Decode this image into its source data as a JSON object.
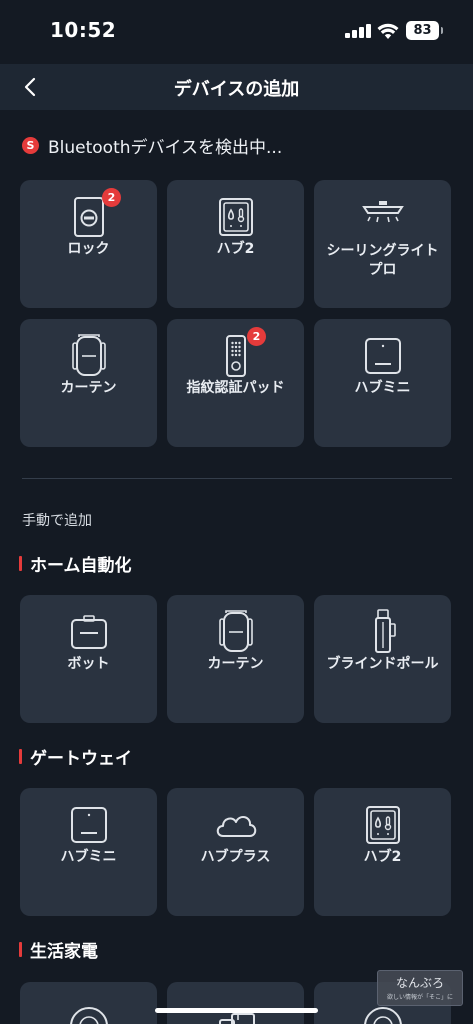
{
  "status": {
    "time": "10:52",
    "battery": "83"
  },
  "nav": {
    "title": "デバイスの追加"
  },
  "scan": {
    "icon_letter": "S",
    "text": "Bluetoothデバイスを検出中..."
  },
  "bluetooth_devices": [
    {
      "label": "ロック",
      "icon": "lock-icon",
      "badge": "2"
    },
    {
      "label": "ハブ2",
      "icon": "hub2-icon"
    },
    {
      "label": "シーリングライト\nプロ",
      "icon": "ceiling-light-icon"
    },
    {
      "label": "カーテン",
      "icon": "curtain-icon"
    },
    {
      "label": "指紋認証パッド",
      "icon": "keypad-icon",
      "badge": "2"
    },
    {
      "label": "ハブミニ",
      "icon": "hub-mini-icon"
    }
  ],
  "manual": {
    "label": "手動で追加"
  },
  "sections": [
    {
      "title": "ホーム自動化",
      "items": [
        {
          "label": "ボット",
          "icon": "bot-icon"
        },
        {
          "label": "カーテン",
          "icon": "curtain-icon"
        },
        {
          "label": "ブラインドポール",
          "icon": "blind-pole-icon"
        }
      ]
    },
    {
      "title": "ゲートウェイ",
      "items": [
        {
          "label": "ハブミニ",
          "icon": "hub-mini-icon"
        },
        {
          "label": "ハブプラス",
          "icon": "cloud-icon"
        },
        {
          "label": "ハブ2",
          "icon": "hub2-icon"
        }
      ]
    },
    {
      "title": "生活家電",
      "items": [
        {
          "label": "",
          "icon": "robot-vacuum-icon"
        },
        {
          "label": "",
          "icon": "appliance-icon"
        },
        {
          "label": "",
          "icon": "robot-vacuum-icon"
        }
      ]
    }
  ],
  "watermark": {
    "title": "なんぶろ",
    "subtitle": "欲しい情報が「そこ」に"
  },
  "colors": {
    "background": "#141a23",
    "card": "#2a3340",
    "accent": "#e53b3b",
    "nav": "#1e2733"
  }
}
